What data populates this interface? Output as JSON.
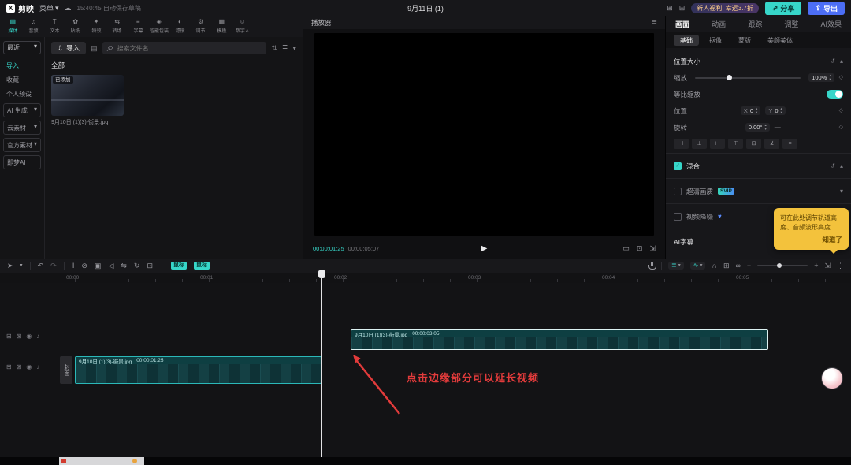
{
  "colors": {
    "accent_teal": "#37d6c9",
    "export_blue": "#4c6ef5",
    "tooltip_yellow": "#f3c23c",
    "annotation_red": "#e23b3b",
    "clip_teal": "#144044"
  },
  "topbar": {
    "logo_mark": "X",
    "logo_text": "剪映",
    "menu": "菜单",
    "autosave": "15:40:45 自动保存草稿",
    "doc_title": "9月11日 (1)",
    "promo": "新人福利, 幸运3.7折",
    "share": "分享",
    "export": "导出"
  },
  "icons": {
    "cloud": "☁",
    "chev": "▾",
    "grid": "⊞",
    "screen": "⊟",
    "share_arrow": "⇗",
    "export_arrow": "⇪",
    "search": "⌕",
    "sort": "⇅",
    "list": "≣",
    "import": "⇩",
    "view": "▤",
    "player_menu": "≣",
    "play": "▶",
    "ratio": "▭",
    "adapt": "⊡",
    "fullscreen": "⇲",
    "reset": "↺",
    "up": "▴",
    "down": "▾",
    "keyframe": "◇",
    "check": "✓",
    "heart": "♥",
    "dash": "—",
    "cursor": "➤",
    "undo": "↶",
    "redo": "↷",
    "split": "‖",
    "delete": "⊘",
    "freeze": "▣",
    "reverse": "◁",
    "mirror": "⇋",
    "rotate": "↻",
    "crop": "⊡",
    "beat": "≣",
    "wave": "∿",
    "magnet": "∩",
    "snap": "⊞",
    "link": "∞",
    "zoom_out": "−",
    "zoom_in": "+",
    "fit": "⇲",
    "kebab": "⋮",
    "track": [
      "⊞",
      "⊠",
      "◉",
      "♪"
    ],
    "align": [
      "⊣",
      "⊥",
      "⊢",
      "⊤",
      "⊟",
      "⊻",
      "≡"
    ]
  },
  "resource_tabs": [
    {
      "icon": "▤",
      "label": "媒体",
      "active": true
    },
    {
      "icon": "♫",
      "label": "音频"
    },
    {
      "icon": "T",
      "label": "文本"
    },
    {
      "icon": "✿",
      "label": "贴纸"
    },
    {
      "icon": "✦",
      "label": "特效"
    },
    {
      "icon": "⇆",
      "label": "转场"
    },
    {
      "icon": "≡",
      "label": "字幕"
    },
    {
      "icon": "◈",
      "label": "智能包装"
    },
    {
      "icon": "◐",
      "label": "滤镜"
    },
    {
      "icon": "⚙",
      "label": "调节"
    },
    {
      "icon": "▦",
      "label": "模板"
    },
    {
      "icon": "☺",
      "label": "数字人"
    }
  ],
  "library": {
    "recent_dropdown": "最近",
    "sidebar": [
      {
        "label": "导入",
        "active": true
      },
      {
        "label": "收藏"
      },
      {
        "label": "个人预设"
      },
      {
        "label": "AI 生成",
        "chevron": "▾"
      },
      {
        "label": "云素材",
        "chevron": "▾"
      },
      {
        "label": "官方素材",
        "chevron": "▾"
      },
      {
        "label": "即梦AI"
      }
    ],
    "import_button": "导入",
    "search_placeholder": "搜索文件名",
    "filter_all": "全部",
    "media_item": {
      "name": "9月10日 (1)(3)-街景.jpg",
      "badge": "已添加"
    }
  },
  "player": {
    "title": "播放器",
    "current_time": "00:00:01:25",
    "total_time": "00:00:05:07"
  },
  "props": {
    "tabs": [
      {
        "label": "画面",
        "active": true
      },
      {
        "label": "动画"
      },
      {
        "label": "跟踪"
      },
      {
        "label": "调整"
      },
      {
        "label": "AI效果"
      }
    ],
    "subtabs": [
      {
        "label": "基础",
        "active": true
      },
      {
        "label": "抠像"
      },
      {
        "label": "蒙版"
      },
      {
        "label": "美颜美体"
      }
    ],
    "position_size": "位置大小",
    "scale": "缩放",
    "scale_value": "100%",
    "uniform": "等比缩放",
    "position": "位置",
    "x": "X",
    "x_value": "0",
    "y": "Y",
    "y_value": "0",
    "rotate": "旋转",
    "rotate_value": "0.00°",
    "blend": "混合",
    "hd": "超清画质",
    "hd_badge": "SVIP",
    "denoise": "视频降噪",
    "ai_caption": "AI字幕"
  },
  "tooltip": {
    "text": "可在此处调节轨道高度、音频波形高度",
    "ok": "知道了"
  },
  "timeline": {
    "mouse_badges": [
      "鼠标",
      "鼠标"
    ],
    "ruler": [
      "00:00",
      "00:01",
      "00:02",
      "00:03",
      "00:04",
      "00:05"
    ],
    "cover": "封面",
    "clips": [
      {
        "name": "9月10日 (1)(3)-街景.jpg",
        "duration": "00:00:03:05"
      },
      {
        "name": "9月10日 (1)(3)-街景.jpg",
        "duration": "00:00:01:25"
      }
    ],
    "annotation": "点击边缘部分可以延长视频"
  }
}
